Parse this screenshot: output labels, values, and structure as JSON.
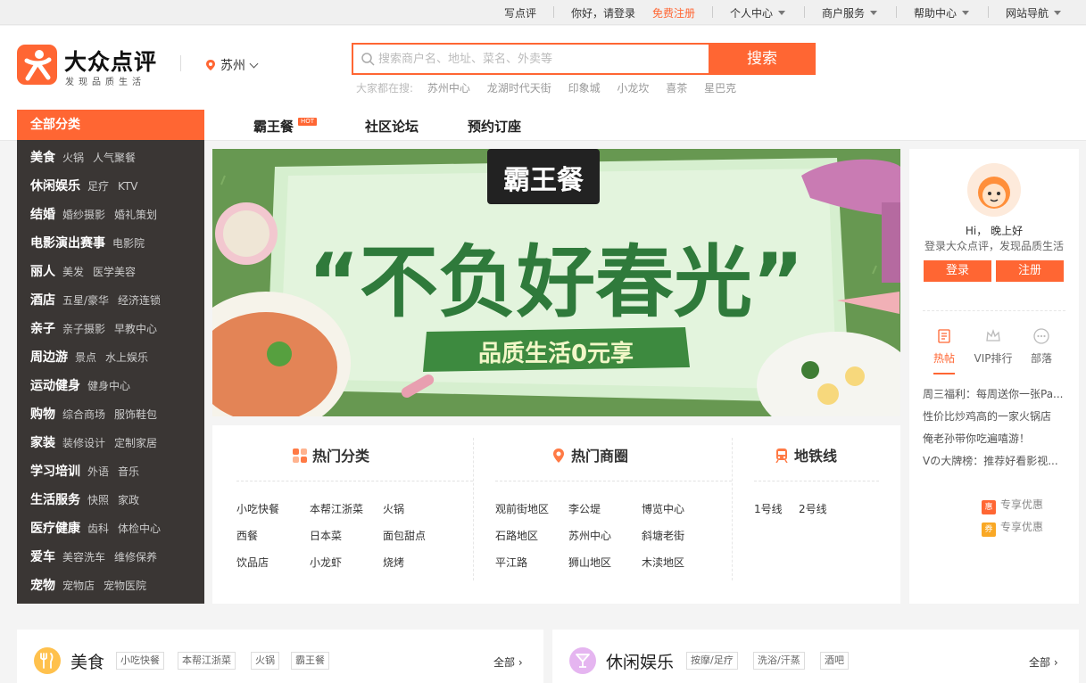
{
  "topbar": {
    "write_review": "写点评",
    "greeting": "你好，请登录",
    "register": "免费注册",
    "personal_center": "个人中心",
    "merchant_service": "商户服务",
    "help_center": "帮助中心",
    "site_nav": "网站导航"
  },
  "header": {
    "logo_text": "大众点评",
    "logo_sub": "发现品质生活",
    "city": "苏州",
    "search_placeholder": "搜索商户名、地址、菜名、外卖等",
    "search_button": "搜索",
    "hot_label": "大家都在搜:",
    "hot_words": [
      "苏州中心",
      "龙湖时代天街",
      "印象城",
      "小龙坎",
      "喜茶",
      "星巴克"
    ]
  },
  "nav": {
    "all_categories": "全部分类",
    "items": [
      "霸王餐",
      "社区论坛",
      "预约订座"
    ],
    "hot_badge": "HOT"
  },
  "sidebar": [
    {
      "main": "美食",
      "subs": [
        "火锅",
        "人气聚餐"
      ]
    },
    {
      "main": "休闲娱乐",
      "subs": [
        "足疗",
        "KTV"
      ]
    },
    {
      "main": "结婚",
      "subs": [
        "婚纱摄影",
        "婚礼策划"
      ]
    },
    {
      "main": "电影演出赛事",
      "subs": [
        "电影院"
      ]
    },
    {
      "main": "丽人",
      "subs": [
        "美发",
        "医学美容"
      ]
    },
    {
      "main": "酒店",
      "subs": [
        "五星/豪华",
        "经济连锁"
      ]
    },
    {
      "main": "亲子",
      "subs": [
        "亲子摄影",
        "早教中心"
      ]
    },
    {
      "main": "周边游",
      "subs": [
        "景点",
        "水上娱乐"
      ]
    },
    {
      "main": "运动健身",
      "subs": [
        "健身中心"
      ]
    },
    {
      "main": "购物",
      "subs": [
        "综合商场",
        "服饰鞋包"
      ]
    },
    {
      "main": "家装",
      "subs": [
        "装修设计",
        "定制家居"
      ]
    },
    {
      "main": "学习培训",
      "subs": [
        "外语",
        "音乐"
      ]
    },
    {
      "main": "生活服务",
      "subs": [
        "快照",
        "家政"
      ]
    },
    {
      "main": "医疗健康",
      "subs": [
        "齿科",
        "体检中心"
      ]
    },
    {
      "main": "爱车",
      "subs": [
        "美容洗车",
        "维修保养"
      ]
    },
    {
      "main": "宠物",
      "subs": [
        "宠物店",
        "宠物医院"
      ]
    }
  ],
  "banner": {
    "badge": "霸王餐",
    "headline": "“不负好春光”",
    "tagline": "品质生活0元享"
  },
  "hot_categories": {
    "title": "热门分类",
    "links": [
      [
        "小吃快餐",
        "本帮江浙菜",
        "火锅"
      ],
      [
        "西餐",
        "日本菜",
        "面包甜点"
      ],
      [
        "饮品店",
        "小龙虾",
        "烧烤"
      ]
    ]
  },
  "hot_districts": {
    "title": "热门商圈",
    "links": [
      [
        "观前街地区",
        "李公堤",
        "博览中心"
      ],
      [
        "石路地区",
        "苏州中心",
        "斜塘老街"
      ],
      [
        "平江路",
        "狮山地区",
        "木渎地区"
      ]
    ]
  },
  "subway": {
    "title": "地铁线",
    "links": [
      "1号线",
      "2号线"
    ]
  },
  "user_panel": {
    "hi": "Hi， 晚上好",
    "prompt": "登录大众点评，发现品质生活",
    "login": "登录",
    "register": "注册",
    "tabs": [
      "热帖",
      "VIP排行",
      "部落"
    ],
    "news": [
      "周三福利：每周送你一张Pa...",
      "性价比炒鸡高的一家火锅店",
      "俺老孙带你吃遍嘻游！",
      "Vの大牌榜：推荐好看影视..."
    ],
    "promo_icons": [
      "惠",
      "券"
    ],
    "promos": [
      "专享优惠",
      "专享优惠"
    ]
  },
  "bottom": {
    "food": {
      "title": "美食",
      "tags": [
        "小吃快餐",
        "本帮江浙菜",
        "火锅",
        "霸王餐"
      ],
      "all": "全部"
    },
    "leisure": {
      "title": "休闲娱乐",
      "tags": [
        "按摩/足疗",
        "洗浴/汗蒸",
        "酒吧"
      ],
      "all": "全部"
    }
  },
  "colors": {
    "brand": "#ff6633",
    "sidebar_bg": "#3a3634"
  }
}
